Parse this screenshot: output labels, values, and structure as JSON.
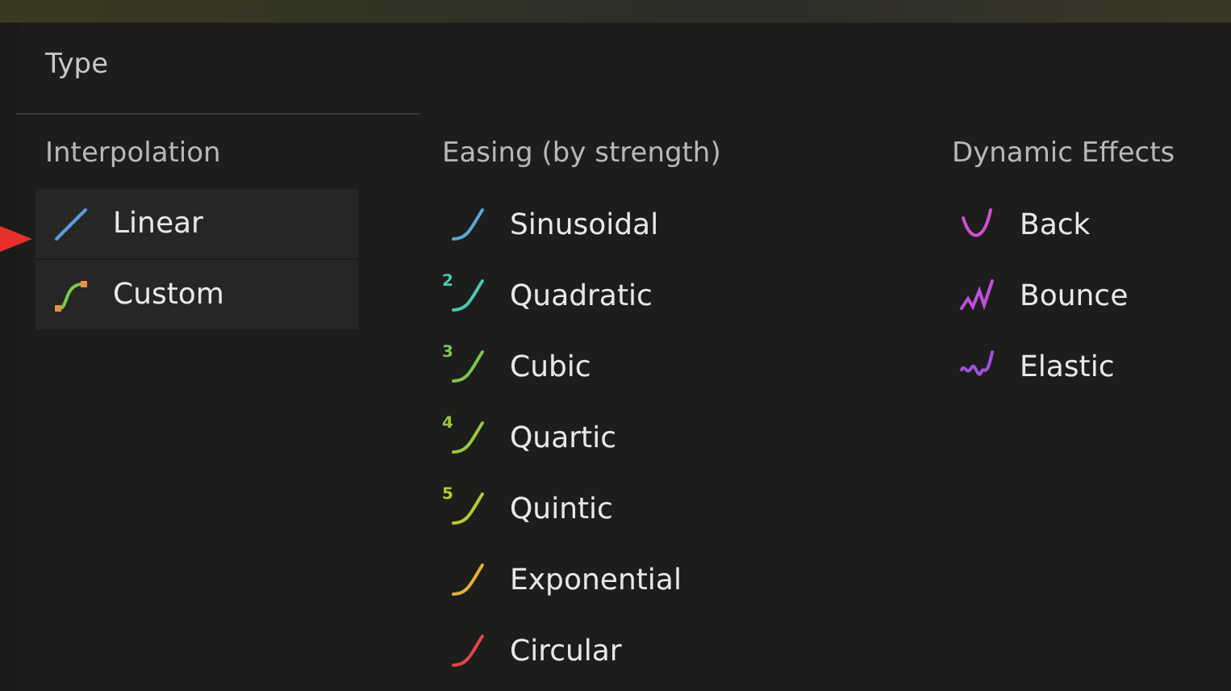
{
  "menu": {
    "title": "Type",
    "columns": [
      {
        "heading": "Interpolation",
        "items": [
          {
            "label": "Linear",
            "kind": "line",
            "color": "#5a9ee0"
          },
          {
            "label": "Custom",
            "kind": "custom",
            "color": "#7cc84a"
          }
        ]
      },
      {
        "heading": "Easing (by strength)",
        "items": [
          {
            "label": "Sinusoidal",
            "kind": "ease",
            "color": "#58a8d8"
          },
          {
            "label": "Quadratic",
            "kind": "ease",
            "badge": "2",
            "color": "#4cc8b0"
          },
          {
            "label": "Cubic",
            "kind": "ease",
            "badge": "3",
            "color": "#78c850"
          },
          {
            "label": "Quartic",
            "kind": "ease",
            "badge": "4",
            "color": "#98c840"
          },
          {
            "label": "Quintic",
            "kind": "ease",
            "badge": "5",
            "color": "#b8c838"
          },
          {
            "label": "Exponential",
            "kind": "ease",
            "color": "#e0b038"
          },
          {
            "label": "Circular",
            "kind": "ease",
            "color": "#e04848"
          }
        ]
      },
      {
        "heading": "Dynamic Effects",
        "items": [
          {
            "label": "Back",
            "kind": "back",
            "color": "#d050d0"
          },
          {
            "label": "Bounce",
            "kind": "bounce",
            "color": "#c050e0"
          },
          {
            "label": "Elastic",
            "kind": "elastic",
            "color": "#a050e0"
          }
        ]
      }
    ]
  }
}
